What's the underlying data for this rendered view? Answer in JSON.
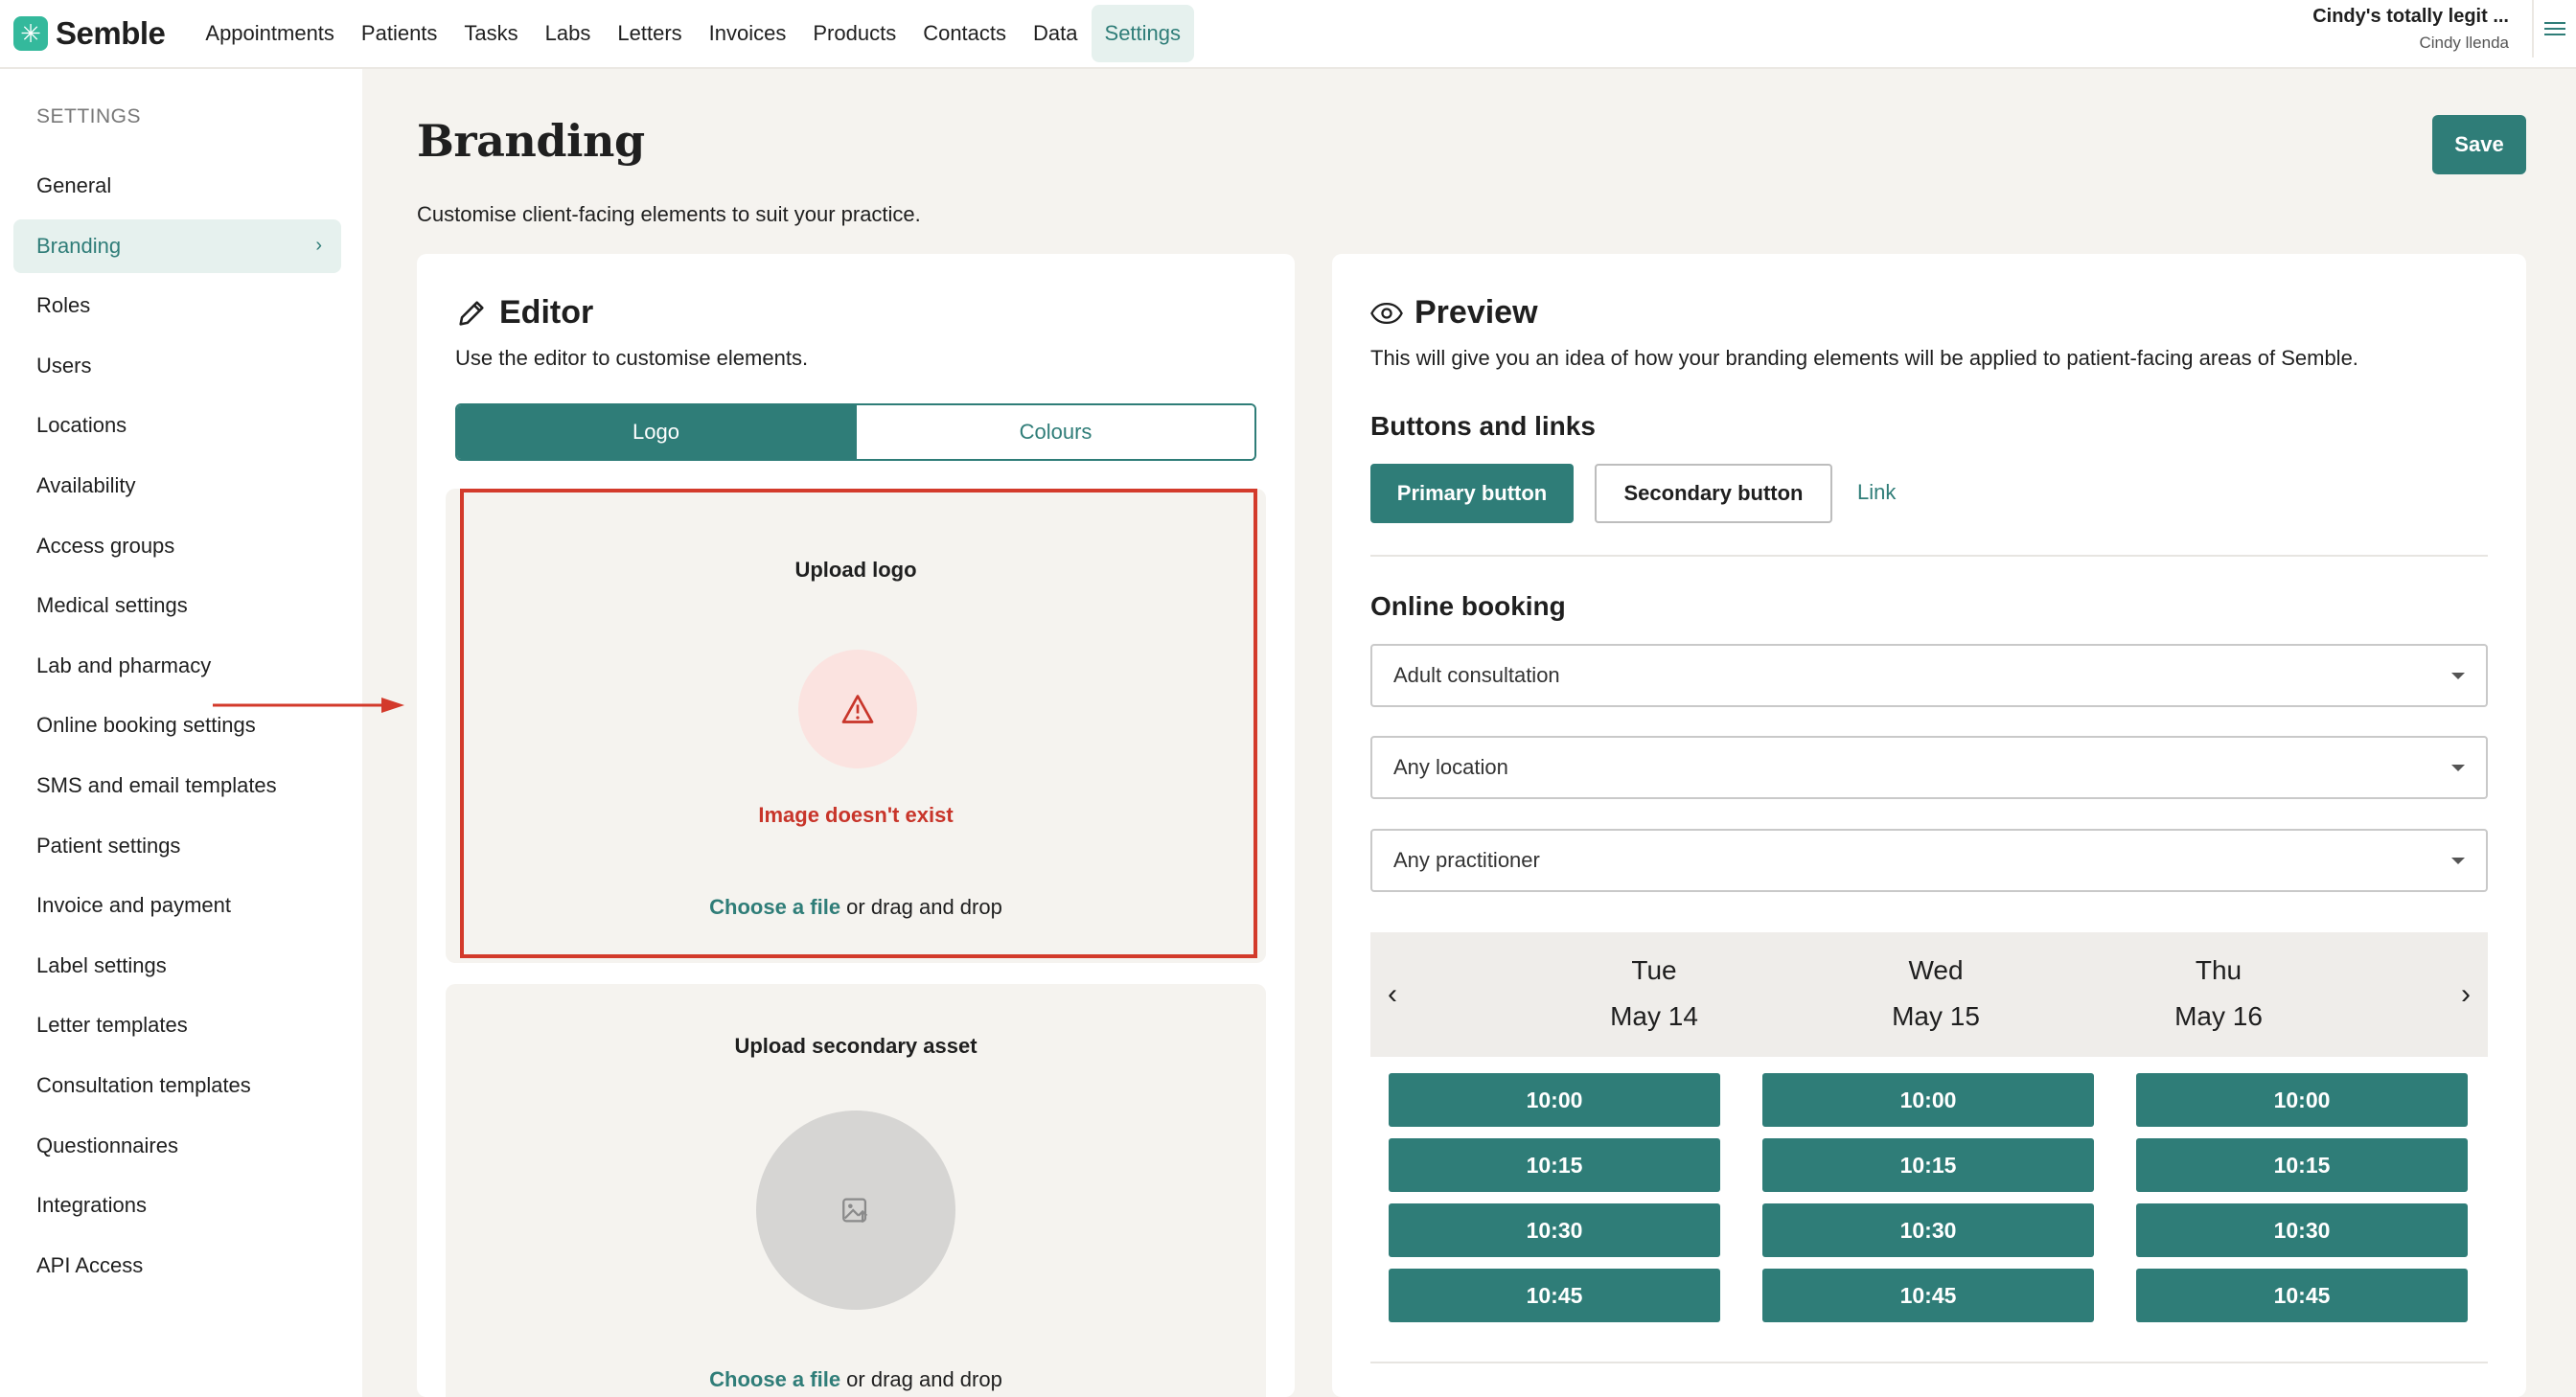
{
  "app": {
    "name": "Semble"
  },
  "nav": {
    "items": [
      "Appointments",
      "Patients",
      "Tasks",
      "Labs",
      "Letters",
      "Invoices",
      "Products",
      "Contacts",
      "Data",
      "Settings"
    ],
    "active": "Settings"
  },
  "user": {
    "org": "Cindy's totally legit ...",
    "name": "Cindy llenda"
  },
  "sidebar": {
    "heading": "SETTINGS",
    "items": [
      "General",
      "Branding",
      "Roles",
      "Users",
      "Locations",
      "Availability",
      "Access groups",
      "Medical settings",
      "Lab and pharmacy",
      "Online booking settings",
      "SMS and email templates",
      "Patient settings",
      "Invoice and payment",
      "Label settings",
      "Letter templates",
      "Consultation templates",
      "Questionnaires",
      "Integrations",
      "API Access"
    ],
    "active": "Branding"
  },
  "page": {
    "title": "Branding",
    "subtitle": "Customise client-facing elements to suit your practice.",
    "save_label": "Save"
  },
  "editor": {
    "title": "Editor",
    "description": "Use the editor to customise elements.",
    "tabs": [
      {
        "label": "Logo",
        "active": true
      },
      {
        "label": "Colours",
        "active": false
      }
    ],
    "logo_upload": {
      "title": "Upload logo",
      "error": "Image doesn't exist",
      "choose": "Choose a file",
      "drop": " or drag and drop"
    },
    "secondary_upload": {
      "title": "Upload secondary asset",
      "choose": "Choose a file",
      "drop": " or drag and drop"
    }
  },
  "preview": {
    "title": "Preview",
    "description": "This will give you an idea of how your branding elements will be applied to patient-facing areas of Semble.",
    "buttons_heading": "Buttons and links",
    "primary_label": "Primary button",
    "secondary_label": "Secondary button",
    "link_label": "Link",
    "booking_heading": "Online booking",
    "selects": [
      "Adult consultation",
      "Any location",
      "Any practitioner"
    ],
    "days": [
      {
        "dow": "Tue",
        "date": "May 14",
        "slots": [
          "10:00",
          "10:15",
          "10:30",
          "10:45"
        ]
      },
      {
        "dow": "Wed",
        "date": "May 15",
        "slots": [
          "10:00",
          "10:15",
          "10:30",
          "10:45"
        ]
      },
      {
        "dow": "Thu",
        "date": "May 16",
        "slots": [
          "10:00",
          "10:15",
          "10:30",
          "10:45"
        ]
      }
    ]
  },
  "colors": {
    "accent": "#2f7d78",
    "annotation": "#d33a2b",
    "error": "#c8352a"
  },
  "icons": {
    "editor": "pencil-icon",
    "preview": "eye-icon",
    "warning": "warning-triangle-icon",
    "image": "image-upload-icon"
  }
}
